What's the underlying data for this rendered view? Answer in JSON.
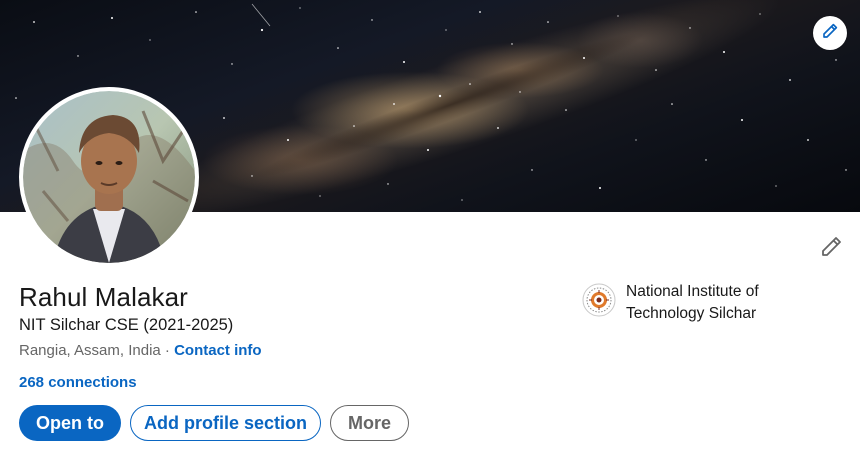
{
  "profile": {
    "name": "Rahul Malakar",
    "headline": "NIT Silchar CSE (2021-2025)",
    "location": "Rangia, Assam, India",
    "location_separator": " · ",
    "contact_info_label": "Contact info",
    "connections_label": "268 connections"
  },
  "education": {
    "institution": "National Institute of Technology Silchar"
  },
  "actions": {
    "open_to_label": "Open to",
    "add_section_label": "Add profile section",
    "more_label": "More"
  },
  "icons": {
    "banner_edit": "pencil-icon",
    "profile_edit": "pencil-icon"
  },
  "colors": {
    "accent": "#0a66c2",
    "text": "#191919",
    "muted": "#666666"
  }
}
